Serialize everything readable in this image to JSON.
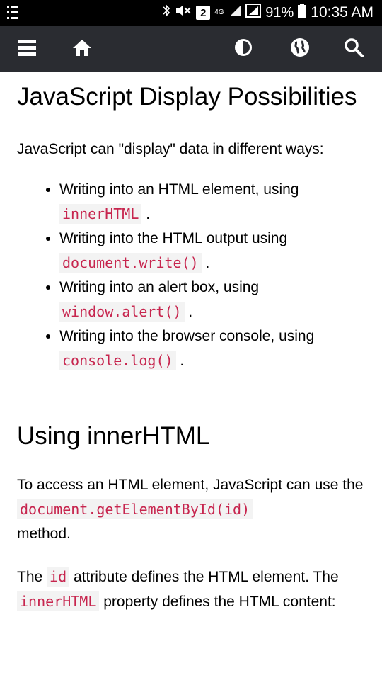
{
  "status": {
    "sim_badge": "2",
    "network": "4G",
    "battery": "91%",
    "time": "10:35 AM"
  },
  "nav": {
    "icons": [
      "menu-icon",
      "home-icon",
      "contrast-icon",
      "globe-icon",
      "search-icon"
    ]
  },
  "page": {
    "title": "JavaScript Display Possibilities",
    "intro": "JavaScript can \"display\" data in different ways:",
    "ways": [
      {
        "text": "Writing into an HTML element, using",
        "code": "innerHTML",
        "end": "."
      },
      {
        "text": "Writing into the HTML output using",
        "code": "document.write()",
        "end": "."
      },
      {
        "text": "Writing into an alert box, using",
        "code": "window.alert()",
        "end": "."
      },
      {
        "text": "Writing into the browser console, using",
        "code": "console.log()",
        "end": "."
      }
    ],
    "section_title": "Using innerHTML",
    "para1": {
      "before": "To access an HTML element, JavaScript can use the",
      "code": "document.getElementById(id)",
      "after": "method."
    },
    "para2": {
      "p1": "The",
      "code1": "id",
      "p2": "attribute defines the HTML element. The",
      "code2": "innerHTML",
      "p3": "property defines the HTML content:"
    }
  }
}
